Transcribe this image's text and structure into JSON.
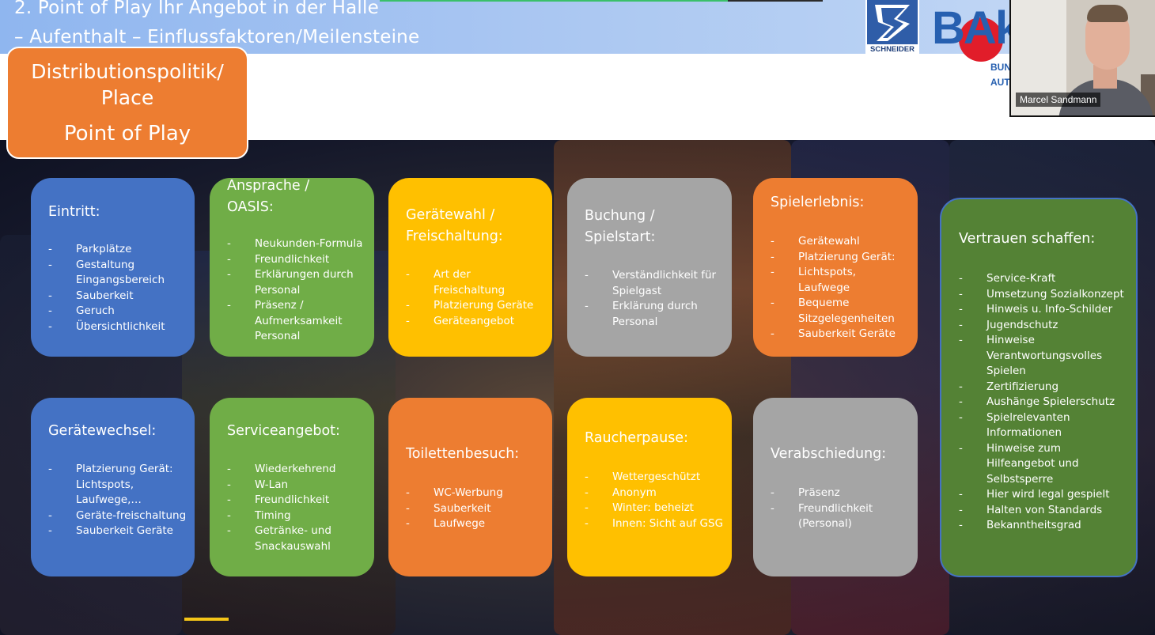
{
  "slide": {
    "title_line1": "2. Point of Play Ihr Angebot in der Halle",
    "title_line2": "– Aufenthalt – Einflussfaktoren/Meilensteine",
    "place_label_line1": "Distributionspolitik/",
    "place_label_line2": "Place",
    "place_label_line3": "Point of Play"
  },
  "logos": {
    "schneider": "SCHNEIDER",
    "bak_letters": "BA",
    "bak_k": "k",
    "bak_sub1": "BUN",
    "bak_sub2": "AUT"
  },
  "webcam": {
    "participant_name": "Marcel Sandmann"
  },
  "colors": {
    "blue": "#4472c4",
    "green": "#70ad47",
    "yellow": "#ffc000",
    "gray": "#a5a5a5",
    "orange": "#ed7d31",
    "dark_green": "#548235"
  },
  "boxes": {
    "eintritt": {
      "title": "Eintritt:",
      "items": [
        "Parkplätze",
        "Gestaltung Eingangsbereich",
        "Sauberkeit",
        "Geruch",
        "Übersichtlichkeit"
      ]
    },
    "ansprache": {
      "title": "Ansprache / OASIS:",
      "items": [
        "Neukunden-Formula",
        "Freundlichkeit",
        "Erklärungen durch Personal",
        "Präsenz / Aufmerksamkeit Personal"
      ]
    },
    "geraetewahl": {
      "title": "Gerätewahl / Freischaltung:",
      "items": [
        "Art der Freischaltung",
        "Platzierung Geräte",
        "Geräteangebot"
      ]
    },
    "buchung": {
      "title": "Buchung / Spielstart:",
      "items": [
        "Verständlichkeit für Spielgast",
        "Erklärung durch Personal"
      ]
    },
    "spielerlebnis": {
      "title": "Spielerlebnis:",
      "items": [
        "Gerätewahl",
        "Platzierung Gerät:",
        "Lichtspots, Laufwege",
        "Bequeme Sitzgelegenheiten",
        "Sauberkeit Geräte"
      ]
    },
    "vertrauen": {
      "title": "Vertrauen schaffen:",
      "items": [
        "Service-Kraft",
        "Umsetzung Sozialkonzept",
        "Hinweis u. Info-Schilder",
        "Jugendschutz",
        "Hinweise Verantwortungsvolles Spielen",
        "Zertifizierung",
        "Aushänge Spielerschutz",
        "Spielrelevanten Informationen",
        "Hinweise zum Hilfeangebot und Selbstsperre",
        "Hier wird legal gespielt",
        "Halten von Standards",
        "Bekanntheitsgrad"
      ]
    },
    "geraetewechsel": {
      "title": "Gerätewechsel:",
      "items": [
        "Platzierung Gerät: Lichtspots, Laufwege,…",
        "Geräte-freischaltung",
        "Sauberkeit Geräte"
      ]
    },
    "serviceangebot": {
      "title": "Serviceangebot:",
      "items": [
        "Wiederkehrend",
        "W-Lan",
        "Freundlichkeit",
        "Timing",
        "Getränke- und Snackauswahl"
      ]
    },
    "toilettenbesuch": {
      "title": "Toilettenbesuch:",
      "items": [
        "WC-Werbung",
        "Sauberkeit",
        "Laufwege"
      ]
    },
    "raucherpause": {
      "title": "Raucherpause:",
      "items": [
        "Wettergeschützt",
        "Anonym",
        "Winter: beheizt",
        "Innen: Sicht auf GSG"
      ]
    },
    "verabschiedung": {
      "title": "Verabschiedung:",
      "items": [
        "Präsenz",
        "Freundlichkeit (Personal)"
      ]
    }
  }
}
